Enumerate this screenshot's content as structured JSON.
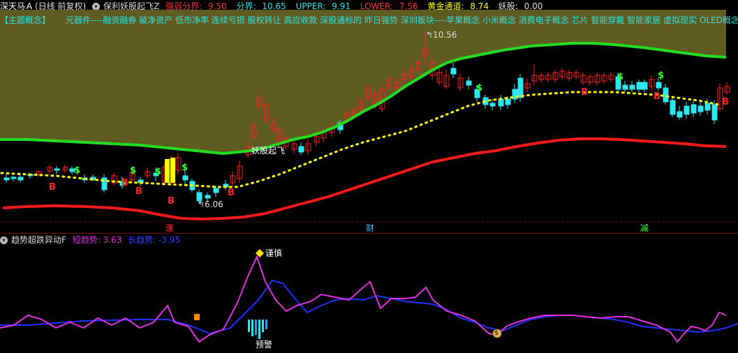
{
  "title_bar": {
    "stock": "深天马Ａ",
    "period": "(日线 前复权)",
    "indicator_name": "保利妖股起飞Z",
    "metrics": [
      {
        "label": "强弱分界:",
        "value": "9.50",
        "color": "#ff3030"
      },
      {
        "label": "分界:",
        "value": "10.65",
        "color": "#2de0e0"
      },
      {
        "label": "UPPER:",
        "value": "9.91",
        "color": "#2de0e0"
      },
      {
        "label": "LOWER:",
        "value": "7.56",
        "color": "#ff3030"
      },
      {
        "label": "黄金通道:",
        "value": "8.74",
        "color": "#ffff00"
      },
      {
        "label": "妖股:",
        "value": "0.00",
        "color": "#e0e0e0"
      }
    ]
  },
  "concepts": {
    "header": "【主题概念】",
    "text": "元器件----融资融券 破净资产 低市净率 连续亏损 股权转让 高应收款 深股通标的 昨日强势 深圳板块----苹果概念 小米概念 消费电子概念 芯片 智能穿戴 智能家居 虚拟现实 OLED概念 M"
  },
  "chart_annotations": {
    "high_price": "10.56",
    "low_price": "6.06",
    "yaogu_label": "妖股起飞",
    "s_marker": "$",
    "b_marker": "B",
    "date_markers": [
      {
        "text": "涨",
        "color": "#ff3030"
      },
      {
        "text": "财",
        "color": "#30c0ff"
      },
      {
        "text": "减",
        "color": "#30ff30"
      }
    ]
  },
  "indicator_bar": {
    "name": "趋势超跌异动F",
    "short_label": "短趋势:",
    "short_value": "3.63",
    "long_label": "长趋势:",
    "long_value": "-3.95"
  },
  "indicator_annotations": {
    "caution": "谨慎",
    "warning": "预警",
    "coin": "$"
  },
  "colors": {
    "up": "#ff2020",
    "down": "#2ee6f0",
    "green_band": "#22dd22",
    "red_band": "#ff1a1a",
    "gold_dots": "#ffff00",
    "olive_fill": "#5f5c22",
    "short_trend": "#e030e0",
    "long_trend": "#2030ff"
  },
  "icons": [
    "settings-circle-icon",
    "dropdown-circle-icon"
  ]
}
